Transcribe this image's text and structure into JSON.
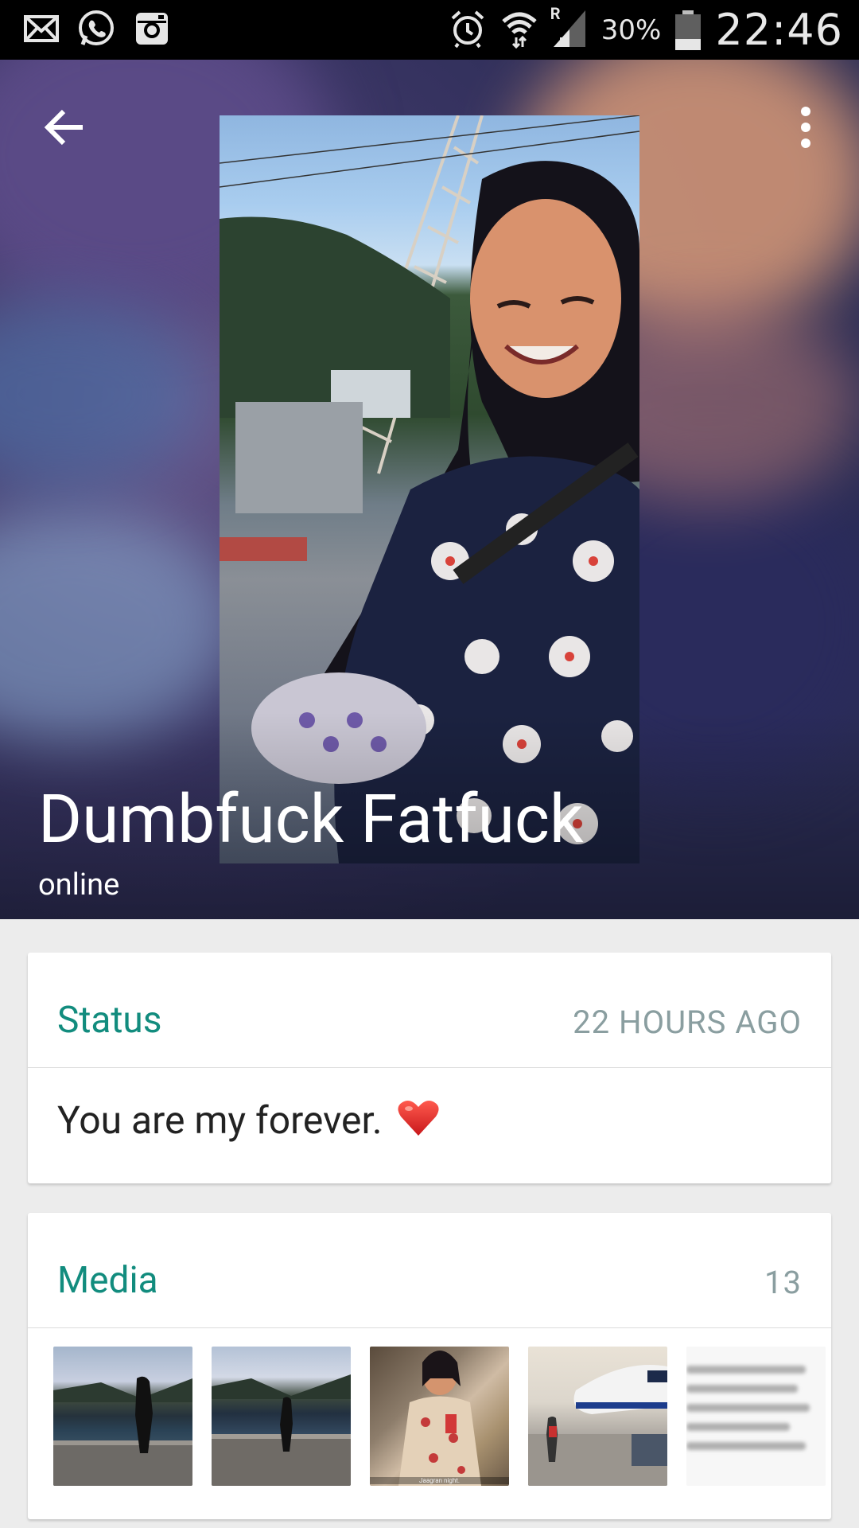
{
  "status_bar": {
    "battery_percent": "30%",
    "time": "22:46",
    "left_icons": [
      "mail-icon",
      "whatsapp-icon",
      "instagram-icon"
    ],
    "right_icons": [
      "alarm-icon",
      "wifi-icon",
      "signal-icon",
      "battery-icon"
    ],
    "roaming_indicator": "R",
    "battery_level": 0.3
  },
  "header": {
    "contact_name": "Dumbfuck Fatfuck",
    "presence": "online",
    "back_icon": "arrow-back-icon",
    "menu_icon": "more-vert-icon"
  },
  "status_card": {
    "title": "Status",
    "time_ago": "22 HOURS AGO",
    "text": "You are my forever.",
    "emoji_icon": "red-heart-icon"
  },
  "media_card": {
    "title": "Media",
    "count": "13",
    "thumbnails": [
      {
        "name": "media-thumb-lake-1"
      },
      {
        "name": "media-thumb-lake-2"
      },
      {
        "name": "media-thumb-portrait",
        "caption": "Jaagran night."
      },
      {
        "name": "media-thumb-airport"
      },
      {
        "name": "media-thumb-text"
      }
    ]
  },
  "colors": {
    "accent": "#128c7e",
    "meta_text": "#8a9ea0",
    "background": "#ececec",
    "status_bar": "#000000"
  }
}
